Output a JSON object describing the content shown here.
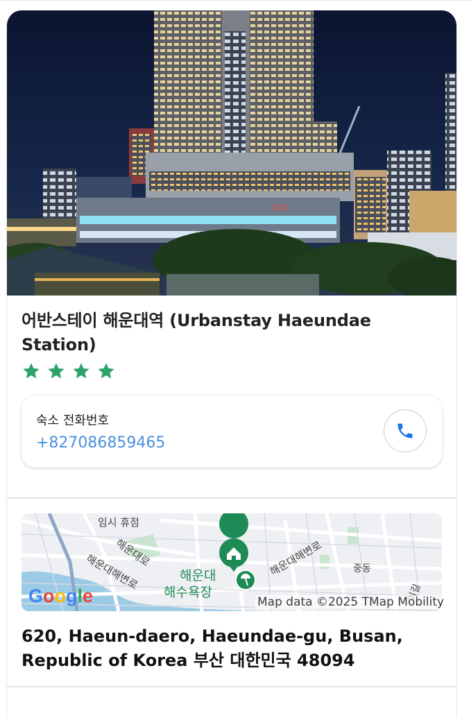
{
  "listing": {
    "title": "어반스테이 해운대역 (Urbanstay Haeundae Station)",
    "star_rating": 4
  },
  "phone": {
    "label": "숙소 전화번호",
    "number": "+827086859465"
  },
  "map": {
    "logo_text": "Google",
    "credit": "Map data ©2025 TMap Mobility",
    "labels": {
      "temp_closed": "임시 휴점",
      "road1": "해운대로",
      "road2": "해운대해변로",
      "beach": "해운대 해수욕장",
      "beach_line1": "해운대",
      "beach_line2": "해수욕장",
      "road3": "해운대해변로",
      "district": "중동",
      "road4": "이길"
    }
  },
  "address": {
    "text": "620, Haeun-daero, Haeundae-gu, Busan, Republic of Korea 부산 대한민국 48094"
  },
  "colors": {
    "star": "#2ea26a",
    "link": "#4a8fe0",
    "call_icon": "#1a73e8",
    "map_pin": "#1e8a55"
  }
}
